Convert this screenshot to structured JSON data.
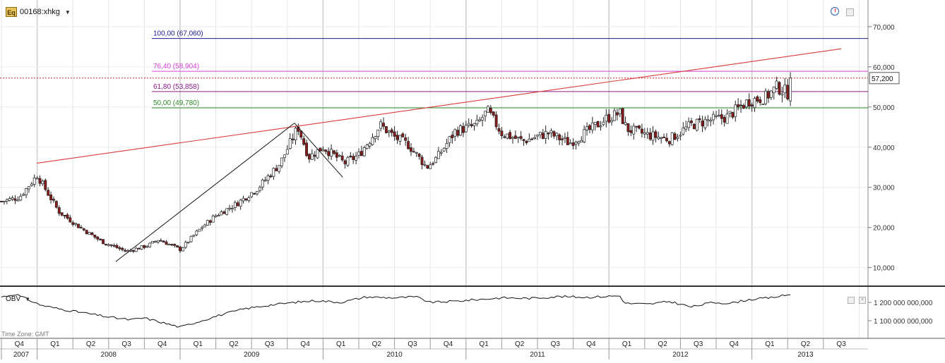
{
  "ticker": {
    "badge": "Eq",
    "symbol": "00168:xhkg"
  },
  "price_axis": {
    "ticks": [
      "70,000",
      "60,000",
      "50,000",
      "40,000",
      "30,000",
      "20,000",
      "10,000"
    ]
  },
  "obv_axis": {
    "ticks": [
      "1 200 000 000,000",
      "1 100 000 000,000"
    ]
  },
  "obv_label": "OBV",
  "timezone": "Time Zone: GMT",
  "last_price": "57,200",
  "fib_levels": [
    {
      "label": "100,00 (67,060)",
      "value": 67060,
      "color": "#1a1a8c"
    },
    {
      "label": "76,40 (58,904)",
      "value": 58904,
      "color": "#d63fd6"
    },
    {
      "label": "61,80 (53,858)",
      "value": 53858,
      "color": "#8a1a8a"
    },
    {
      "label": "50,00 (49,780)",
      "value": 49780,
      "color": "#2a8a2a"
    }
  ],
  "quarters": [
    {
      "label": "Q4",
      "year": 2007
    },
    {
      "label": "Q1",
      "year": 2008
    },
    {
      "label": "Q2",
      "year": 2008
    },
    {
      "label": "Q3",
      "year": 2008
    },
    {
      "label": "Q4",
      "year": 2008
    },
    {
      "label": "Q1",
      "year": 2009
    },
    {
      "label": "Q2",
      "year": 2009
    },
    {
      "label": "Q3",
      "year": 2009
    },
    {
      "label": "Q4",
      "year": 2009
    },
    {
      "label": "Q1",
      "year": 2010
    },
    {
      "label": "Q2",
      "year": 2010
    },
    {
      "label": "Q3",
      "year": 2010
    },
    {
      "label": "Q4",
      "year": 2010
    },
    {
      "label": "Q1",
      "year": 2011
    },
    {
      "label": "Q2",
      "year": 2011
    },
    {
      "label": "Q3",
      "year": 2011
    },
    {
      "label": "Q4",
      "year": 2011
    },
    {
      "label": "Q1",
      "year": 2012
    },
    {
      "label": "Q2",
      "year": 2012
    },
    {
      "label": "Q3",
      "year": 2012
    },
    {
      "label": "Q4",
      "year": 2012
    },
    {
      "label": "Q1",
      "year": 2013
    },
    {
      "label": "Q2",
      "year": 2013
    },
    {
      "label": "Q3",
      "year": 2013
    }
  ],
  "years": [
    "2007",
    "2008",
    "2009",
    "2010",
    "2011",
    "2012",
    "2013"
  ],
  "chart_data": {
    "type": "candlestick",
    "x_unit": "quarter",
    "y_axis": {
      "ticks": [
        10000,
        20000,
        30000,
        40000,
        50000,
        60000,
        70000
      ],
      "range": [
        0,
        74000
      ]
    },
    "price_anchors": [
      {
        "t": 0.0,
        "close": 26500
      },
      {
        "t": 0.5,
        "close": 27500
      },
      {
        "t": 1.0,
        "close": 33000
      },
      {
        "t": 1.6,
        "close": 24000
      },
      {
        "t": 2.2,
        "close": 20000
      },
      {
        "t": 2.8,
        "close": 16500
      },
      {
        "t": 3.5,
        "close": 14000
      },
      {
        "t": 4.1,
        "close": 15500
      },
      {
        "t": 4.4,
        "close": 17000
      },
      {
        "t": 5.0,
        "close": 14500
      },
      {
        "t": 5.6,
        "close": 20000
      },
      {
        "t": 6.0,
        "close": 23000
      },
      {
        "t": 6.6,
        "close": 26000
      },
      {
        "t": 7.2,
        "close": 30000
      },
      {
        "t": 7.8,
        "close": 36000
      },
      {
        "t": 8.3,
        "close": 45000
      },
      {
        "t": 8.6,
        "close": 37500
      },
      {
        "t": 9.0,
        "close": 40000
      },
      {
        "t": 9.6,
        "close": 36000
      },
      {
        "t": 10.0,
        "close": 38000
      },
      {
        "t": 10.6,
        "close": 45500
      },
      {
        "t": 11.0,
        "close": 42500
      },
      {
        "t": 11.4,
        "close": 40500
      },
      {
        "t": 11.9,
        "close": 35000
      },
      {
        "t": 12.2,
        "close": 37500
      },
      {
        "t": 12.7,
        "close": 44000
      },
      {
        "t": 13.3,
        "close": 45500
      },
      {
        "t": 13.6,
        "close": 49000
      },
      {
        "t": 14.0,
        "close": 43500
      },
      {
        "t": 14.6,
        "close": 41500
      },
      {
        "t": 15.3,
        "close": 43500
      },
      {
        "t": 15.9,
        "close": 41000
      },
      {
        "t": 16.5,
        "close": 44500
      },
      {
        "t": 16.9,
        "close": 47000
      },
      {
        "t": 17.3,
        "close": 48500
      },
      {
        "t": 17.5,
        "close": 44500
      },
      {
        "t": 18.1,
        "close": 43000
      },
      {
        "t": 18.7,
        "close": 42000
      },
      {
        "t": 19.3,
        "close": 45500
      },
      {
        "t": 19.7,
        "close": 46500
      },
      {
        "t": 20.3,
        "close": 47500
      },
      {
        "t": 20.9,
        "close": 51500
      },
      {
        "t": 21.4,
        "close": 52500
      },
      {
        "t": 21.7,
        "close": 55000
      },
      {
        "t": 22.0,
        "close": 53500
      },
      {
        "t": 22.15,
        "close": 57200
      }
    ],
    "obv_anchors": [
      {
        "t": 0.0,
        "v": 1.23
      },
      {
        "t": 0.4,
        "v": 1.245
      },
      {
        "t": 1.1,
        "v": 1.185
      },
      {
        "t": 1.6,
        "v": 1.165
      },
      {
        "t": 2.4,
        "v": 1.14
      },
      {
        "t": 3.0,
        "v": 1.12
      },
      {
        "t": 3.6,
        "v": 1.105
      },
      {
        "t": 4.0,
        "v": 1.115
      },
      {
        "t": 4.6,
        "v": 1.085
      },
      {
        "t": 5.0,
        "v": 1.065
      },
      {
        "t": 5.6,
        "v": 1.1
      },
      {
        "t": 6.1,
        "v": 1.13
      },
      {
        "t": 6.8,
        "v": 1.165
      },
      {
        "t": 7.5,
        "v": 1.185
      },
      {
        "t": 8.2,
        "v": 1.2
      },
      {
        "t": 8.8,
        "v": 1.21
      },
      {
        "t": 9.5,
        "v": 1.2
      },
      {
        "t": 10.2,
        "v": 1.23
      },
      {
        "t": 11.0,
        "v": 1.225
      },
      {
        "t": 11.6,
        "v": 1.23
      },
      {
        "t": 12.0,
        "v": 1.2
      },
      {
        "t": 12.6,
        "v": 1.205
      },
      {
        "t": 13.3,
        "v": 1.215
      },
      {
        "t": 14.0,
        "v": 1.225
      },
      {
        "t": 14.8,
        "v": 1.222
      },
      {
        "t": 15.6,
        "v": 1.232
      },
      {
        "t": 16.4,
        "v": 1.228
      },
      {
        "t": 17.3,
        "v": 1.236
      },
      {
        "t": 17.45,
        "v": 1.195
      },
      {
        "t": 18.1,
        "v": 1.19
      },
      {
        "t": 18.7,
        "v": 1.205
      },
      {
        "t": 19.3,
        "v": 1.175
      },
      {
        "t": 19.9,
        "v": 1.2
      },
      {
        "t": 20.4,
        "v": 1.195
      },
      {
        "t": 20.9,
        "v": 1.215
      },
      {
        "t": 21.5,
        "v": 1.225
      },
      {
        "t": 22.15,
        "v": 1.245
      }
    ],
    "trendline": {
      "from": {
        "t": 0.0,
        "price": 36000
      },
      "to": {
        "t": 23.5,
        "price": 64500
      },
      "color": "#d9393a"
    },
    "wave": [
      {
        "t": 3.2,
        "price": 11500
      },
      {
        "t": 8.2,
        "price": 46000
      },
      {
        "t": 9.55,
        "price": 32500
      }
    ],
    "last_line": {
      "price": 57200,
      "color": "#cc2222"
    }
  }
}
